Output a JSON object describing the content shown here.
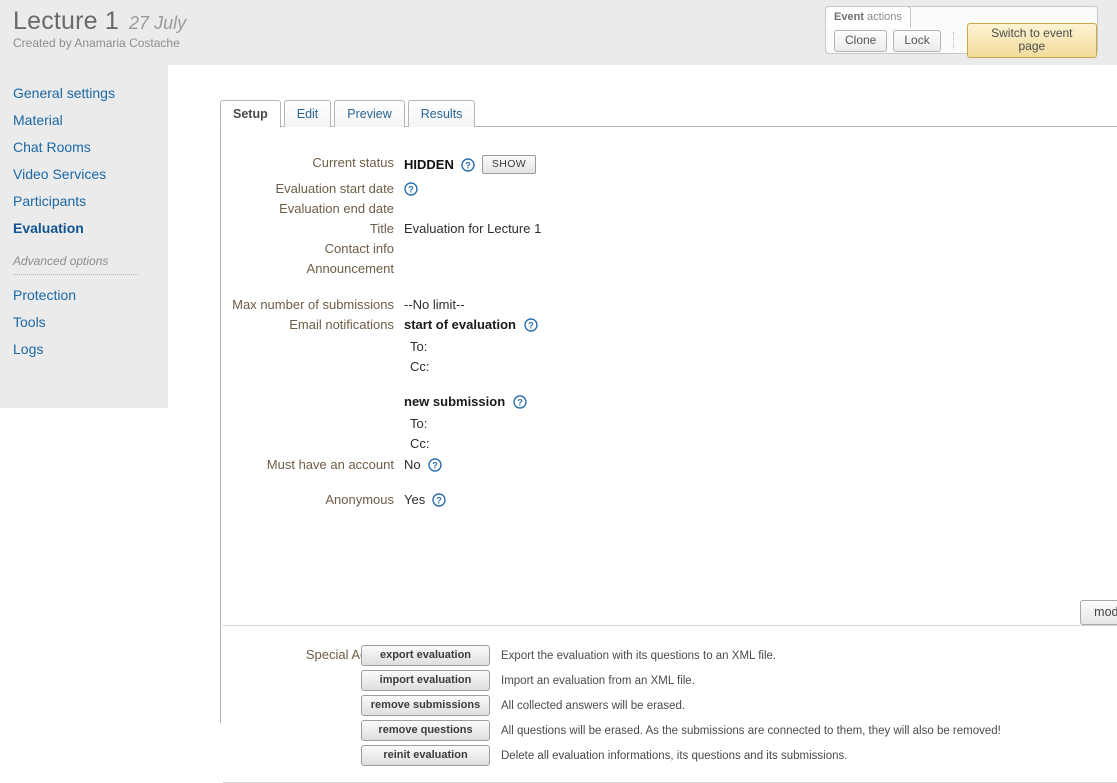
{
  "header": {
    "event_title": "Lecture 1",
    "event_date": "27 July",
    "created_by": "Created by Anamaria Costache",
    "event_actions": {
      "legend_bold": "Event",
      "legend_rest": " actions",
      "clone_label": "Clone",
      "lock_label": "Lock",
      "switch_label": "Switch to event page"
    }
  },
  "sidebar": {
    "items": [
      {
        "label": "General settings",
        "current": false
      },
      {
        "label": "Material",
        "current": false
      },
      {
        "label": "Chat Rooms",
        "current": false
      },
      {
        "label": "Video Services",
        "current": false
      },
      {
        "label": "Participants",
        "current": false
      },
      {
        "label": "Evaluation",
        "current": true
      }
    ],
    "section_label": "Advanced options",
    "advanced_items": [
      {
        "label": "Protection"
      },
      {
        "label": "Tools"
      },
      {
        "label": "Logs"
      }
    ]
  },
  "tabs": [
    {
      "label": "Setup",
      "active": true
    },
    {
      "label": "Edit",
      "active": false
    },
    {
      "label": "Preview",
      "active": false
    },
    {
      "label": "Results",
      "active": false
    }
  ],
  "setup": {
    "current_status": {
      "label": "Current status",
      "value": "HIDDEN",
      "help": "help-icon",
      "button": "SHOW"
    },
    "start_date": {
      "label": "Evaluation start date",
      "value": "",
      "help": "help-icon"
    },
    "end_date": {
      "label": "Evaluation end date",
      "value": ""
    },
    "title": {
      "label": "Title",
      "value": "Evaluation for Lecture 1"
    },
    "contact_info": {
      "label": "Contact info",
      "value": ""
    },
    "announcement": {
      "label": "Announcement",
      "value": ""
    },
    "max_submissions": {
      "label": "Max number of submissions",
      "value": "--No limit--"
    },
    "email_notifications": {
      "label": "Email notifications",
      "groups": [
        {
          "heading": "start of evaluation",
          "to": "To:",
          "cc": "Cc:"
        },
        {
          "heading": "new submission",
          "to": "To:",
          "cc": "Cc:"
        }
      ]
    },
    "must_have_account": {
      "label": "Must have an account",
      "value": "No"
    },
    "anonymous": {
      "label": "Anonymous",
      "value": "Yes"
    },
    "modify_button": "modify"
  },
  "special_actions": {
    "label": "Special Actions",
    "rows": [
      {
        "button": "export evaluation",
        "desc": "Export the evaluation with its questions to an XML file."
      },
      {
        "button": "import evaluation",
        "desc": "Import an evaluation from an XML file."
      },
      {
        "button": "remove submissions",
        "desc": "All collected answers will be erased."
      },
      {
        "button": "remove questions",
        "desc": "All questions will be erased. As the submissions are connected to them, they will also be removed!"
      },
      {
        "button": "reinit evaluation",
        "desc": "Delete all evaluation informations, its questions and its submissions."
      }
    ]
  },
  "colors": {
    "link": "#1b68a5",
    "label": "#6e5c46",
    "header_bg": "#ebebeb",
    "accent_button": "#f2dc9c"
  }
}
